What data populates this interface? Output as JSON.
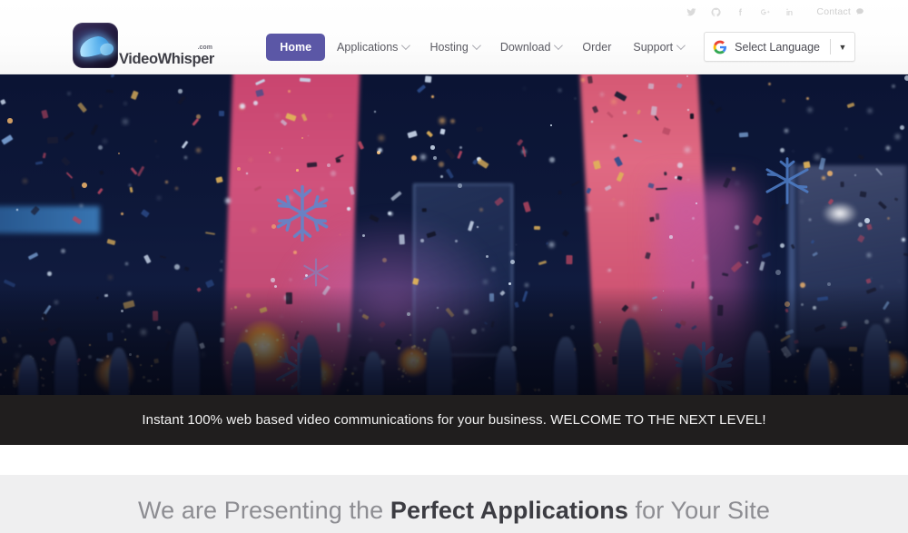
{
  "header": {
    "logo": {
      "name": "VideoWhisper",
      "tld": ".com",
      "icon": "videowhisper-swoosh-logo"
    },
    "social": [
      {
        "name": "twitter-icon",
        "label": "Twitter"
      },
      {
        "name": "github-icon",
        "label": "GitHub"
      },
      {
        "name": "facebook-icon",
        "label": "Facebook"
      },
      {
        "name": "google-plus-icon",
        "label": "Google Plus"
      },
      {
        "name": "linkedin-icon",
        "label": "LinkedIn"
      }
    ],
    "contact": {
      "label": "Contact",
      "icon": "chat-bubble-icon"
    },
    "nav": [
      {
        "label": "Home",
        "active": true,
        "has_dropdown": false
      },
      {
        "label": "Applications",
        "active": false,
        "has_dropdown": true
      },
      {
        "label": "Hosting",
        "active": false,
        "has_dropdown": true
      },
      {
        "label": "Download",
        "active": false,
        "has_dropdown": true
      },
      {
        "label": "Order",
        "active": false,
        "has_dropdown": false
      },
      {
        "label": "Support",
        "active": false,
        "has_dropdown": true
      }
    ],
    "translate": {
      "icon": "google-g-icon",
      "selected": "Select Language",
      "arrow": "▼"
    },
    "accent_color": "#5b57a6"
  },
  "hero": {
    "alt": "New Year celebration crowd holding sparklers with confetti, snowflakes and pink stage curtains",
    "palette": {
      "night_blue": "#0d1738",
      "curtain_pink": "#d0527c",
      "spark_gold": "#ffd271",
      "snowflake_blue": "#4f7fc9"
    }
  },
  "banner": {
    "text": "Instant 100% web based video communications for your business. WELCOME TO THE NEXT LEVEL!",
    "background": "#201e1e",
    "color": "#f2f2f2"
  },
  "section": {
    "title_before": "We are Presenting the ",
    "title_bold": "Perfect Applications",
    "title_after": " for Your Site",
    "background": "#efeff0"
  }
}
